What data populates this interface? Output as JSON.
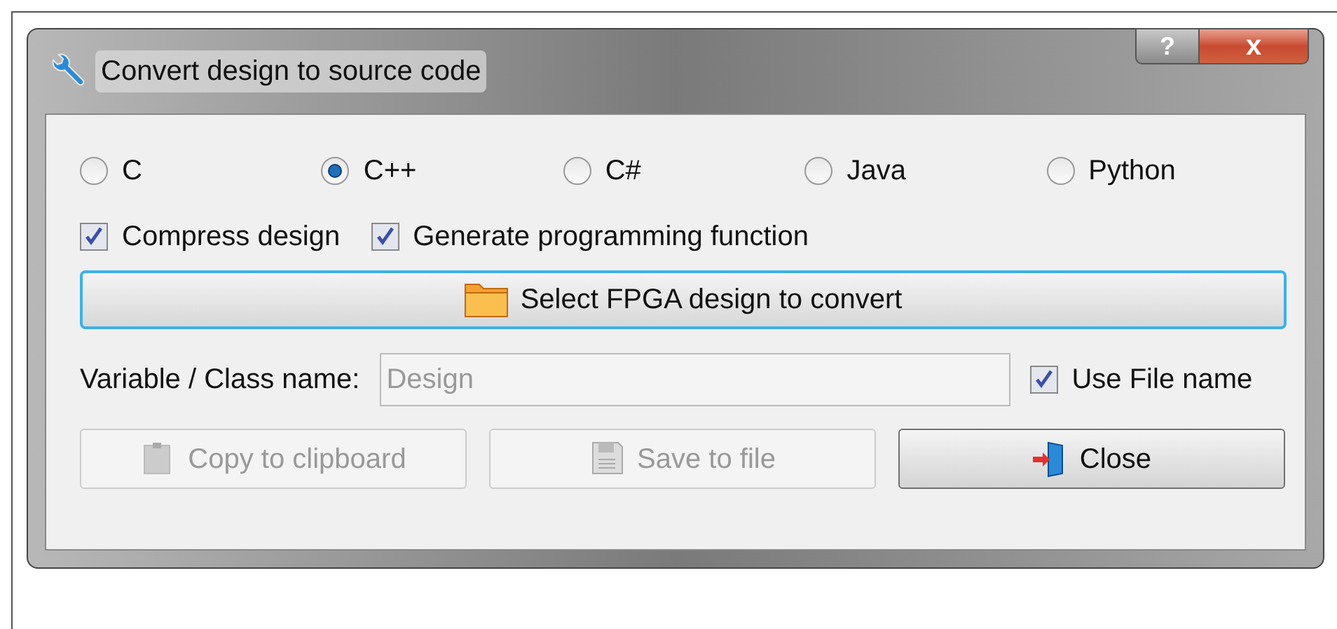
{
  "window": {
    "title": "Convert design to source code",
    "help_button": "?",
    "close_button": "x"
  },
  "languages": [
    {
      "label": "C",
      "selected": false
    },
    {
      "label": "C++",
      "selected": true
    },
    {
      "label": "C#",
      "selected": false
    },
    {
      "label": "Java",
      "selected": false
    },
    {
      "label": "Python",
      "selected": false
    }
  ],
  "options": [
    {
      "label": "Compress design",
      "checked": true
    },
    {
      "label": "Generate programming function",
      "checked": true
    }
  ],
  "select_button": {
    "label": "Select FPGA design to convert"
  },
  "name_field": {
    "label": "Variable / Class name:",
    "value": "Design",
    "disabled": true
  },
  "use_file_name": {
    "label": "Use File name",
    "checked": true
  },
  "buttons": [
    {
      "kind": "clipboard",
      "label": "Copy to clipboard",
      "disabled": true
    },
    {
      "kind": "save",
      "label": "Save to file",
      "disabled": true
    },
    {
      "kind": "close",
      "label": "Close",
      "disabled": false
    }
  ]
}
